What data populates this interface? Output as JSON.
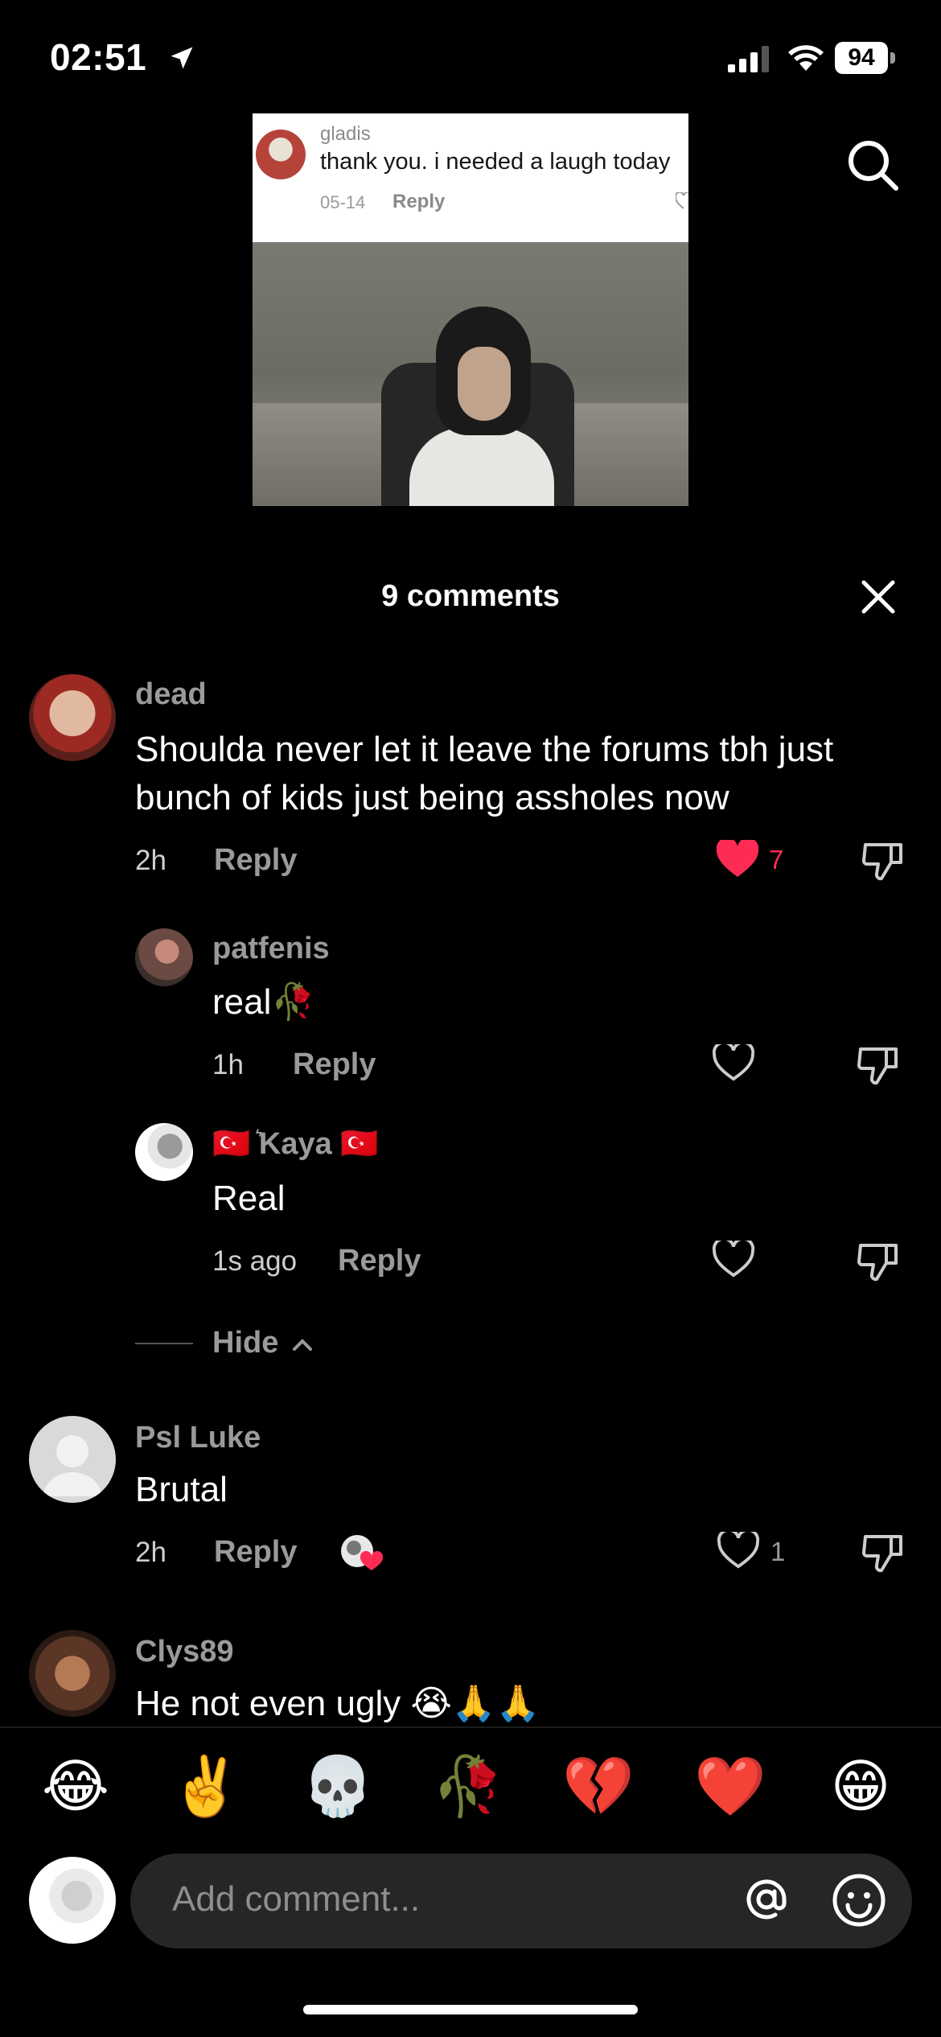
{
  "status_bar": {
    "time": "02:51",
    "battery": "94"
  },
  "video": {
    "reference_comment": {
      "username": "gladis",
      "text": "thank you. i needed a laugh today",
      "date": "05-14",
      "reply_label": "Reply"
    }
  },
  "header": {
    "title": "9 comments"
  },
  "comments": [
    {
      "username": "dead",
      "text": "Shoulda never let it leave the forums tbh just bunch of kids just being assholes now",
      "time": "2h",
      "reply_label": "Reply",
      "likes": "7",
      "liked": true
    },
    {
      "username": "patfenis",
      "text": "real🥀",
      "time": "1h",
      "reply_label": "Reply",
      "likes": ""
    },
    {
      "username": "🇹🇷 ͛Kaya 🇹🇷",
      "text": "Real",
      "time": "1s ago",
      "reply_label": "Reply",
      "likes": ""
    },
    {
      "username": "Psl Luke",
      "text": "Brutal",
      "time": "2h",
      "reply_label": "Reply",
      "likes": "1"
    },
    {
      "username": "Clys89",
      "text": "He not even ugly 😭🙏🙏"
    }
  ],
  "hide_label": "Hide",
  "quick_emojis": [
    "😂",
    "✌️",
    "💀",
    "🥀",
    "💔",
    "❤️",
    "😁"
  ],
  "input": {
    "placeholder": "Add comment..."
  },
  "colors": {
    "like_red": "#fe2c55",
    "background": "#000000",
    "input_bg": "#262626"
  }
}
